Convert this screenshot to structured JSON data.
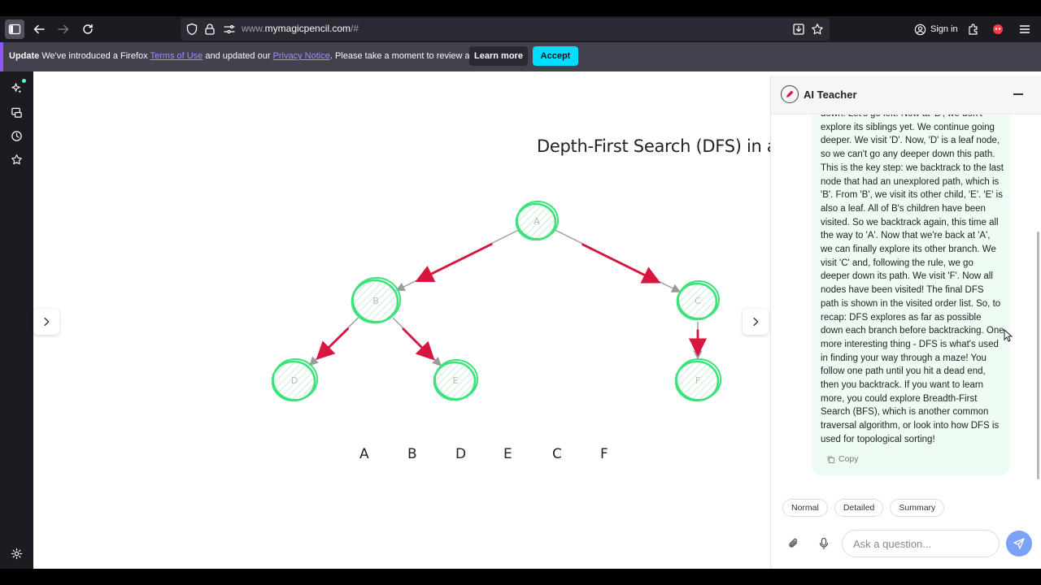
{
  "browser": {
    "url_prefix": "www.",
    "url_host": "mymagicpencil.com",
    "url_suffix": "/#",
    "signin_label": "Sign in",
    "icons": [
      "sidebar-icon",
      "back-icon",
      "forward-icon",
      "reload-icon",
      "shield-icon",
      "lock-icon",
      "permissions-icon",
      "save-page-icon",
      "bookmark-star-icon",
      "account-icon",
      "extensions-icon",
      "profile-icon",
      "menu-icon"
    ]
  },
  "notification": {
    "bold": "Update",
    "text_1": " We've introduced a Firefox ",
    "link_terms": "Terms of Use",
    "text_2": " and updated our ",
    "link_privacy": "Privacy Notice",
    "text_3": ". Please take a moment to review and accept.",
    "learn_more": "Learn more",
    "accept": "Accept"
  },
  "canvas": {
    "title": "Depth-First Search (DFS) in a Tr",
    "nodes": [
      {
        "id": "A",
        "label": "A"
      },
      {
        "id": "B",
        "label": "B"
      },
      {
        "id": "C",
        "label": "C"
      },
      {
        "id": "D",
        "label": "D"
      },
      {
        "id": "E",
        "label": "E"
      },
      {
        "id": "F",
        "label": "F"
      }
    ],
    "edges": [
      [
        "A",
        "B"
      ],
      [
        "A",
        "C"
      ],
      [
        "B",
        "D"
      ],
      [
        "B",
        "E"
      ],
      [
        "C",
        "F"
      ]
    ],
    "visited_order": [
      "A",
      "B",
      "D",
      "E",
      "C",
      "F"
    ],
    "colors": {
      "node": "#3ce27a",
      "edge": "#d7153f",
      "arrow": "#9a9a9a"
    }
  },
  "panel": {
    "title": "AI Teacher",
    "message": "down. Let's go left. Now at 'B', we don't explore its siblings yet. We continue going deeper. We visit 'D'. Now, 'D' is a leaf node, so we can't go any deeper down this path. This is the key step: we backtrack to the last node that had an unexplored path, which is 'B'. From 'B', we visit its other child, 'E'. 'E' is also a leaf. All of B's children have been visited. So we backtrack again, this time all the way to 'A'. Now that we're back at 'A', we can finally explore its other branch. We visit 'C' and, following the rule, we go deeper down its path. We visit 'F'. Now all nodes have been visited! The final DFS path is shown in the visited order list. So, to recap: DFS explores as far as possible down each branch before backtracking. One more interesting thing - DFS is what's used in finding your way through a maze! You follow one path until you hit a dead end, then you backtrack. If you want to learn more, you could explore Breadth-First Search (BFS), which is another common traversal algorithm, or look into how DFS is used for topological sorting!",
    "copy_label": "Copy",
    "modes": [
      "Normal",
      "Detailed",
      "Summary"
    ],
    "input_placeholder": "Ask a question..."
  }
}
